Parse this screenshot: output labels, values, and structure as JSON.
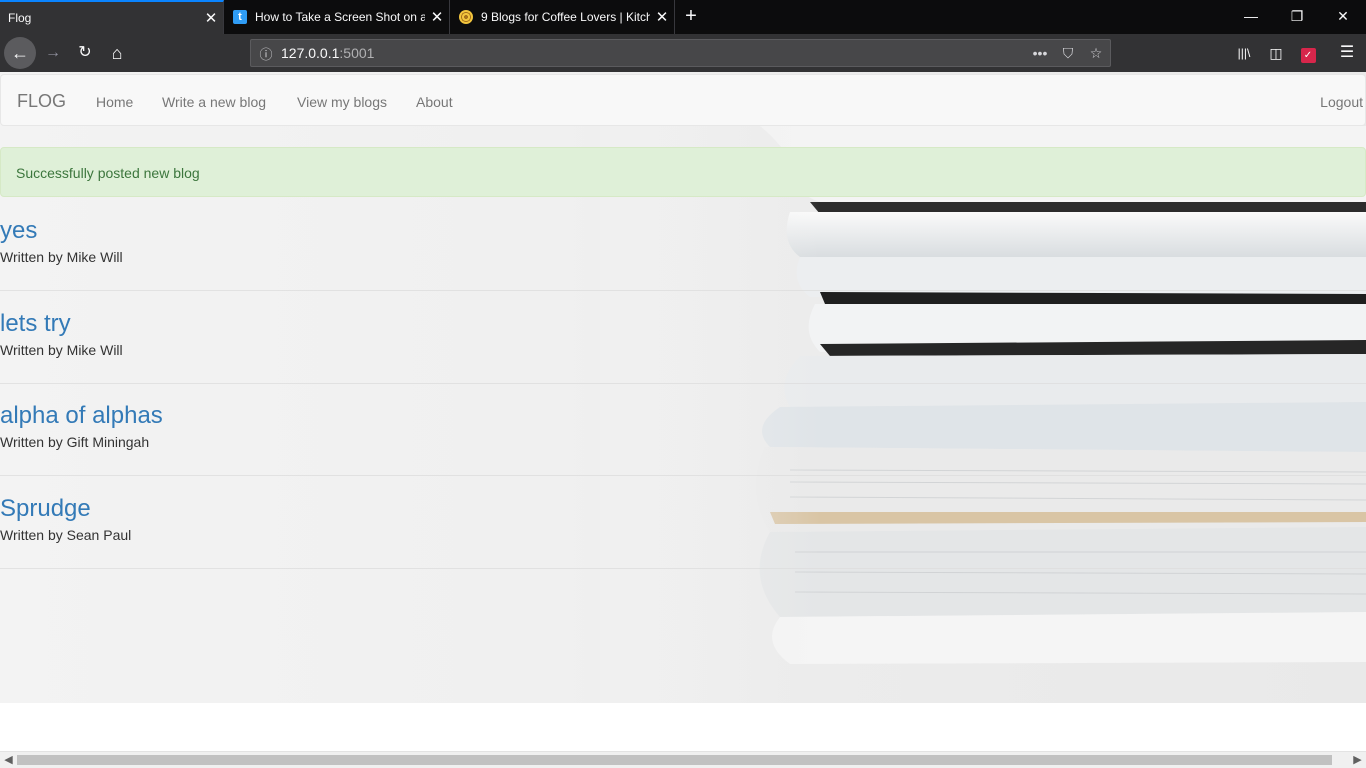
{
  "browser": {
    "tabs": [
      {
        "title": "Flog",
        "active": true
      },
      {
        "title": "How to Take a Screen Shot on a",
        "favicon_letter": "t"
      },
      {
        "title": "9 Blogs for Coffee Lovers | Kitch"
      }
    ],
    "new_tab": "+",
    "window_controls": {
      "minimize": "—",
      "restore": "❐",
      "close": "✕"
    },
    "nav": {
      "back": "←",
      "forward": "→",
      "reload": "↻",
      "home": "⌂"
    },
    "url": {
      "info_icon": "ⓘ",
      "host": "127.0.0.1",
      "port": ":5001"
    },
    "url_actions": {
      "more": "•••",
      "pocket": "⛉",
      "bookmark": "☆"
    },
    "toolbar": {
      "library": "|||\\",
      "sidebar": "◫",
      "pocket": "✓",
      "menu": "☰"
    }
  },
  "site": {
    "brand": "FLOG",
    "nav_links": [
      "Home",
      "Write a new blog",
      "View my blogs",
      "About"
    ],
    "logout": "Logout"
  },
  "alert": "Successfully posted new blog",
  "posts": [
    {
      "title": "yes",
      "author": "Written by Mike Will"
    },
    {
      "title": "lets try",
      "author": "Written by Mike Will"
    },
    {
      "title": "alpha of alphas",
      "author": "Written by Gift Miningah"
    },
    {
      "title": "Sprudge",
      "author": "Written by Sean Paul"
    }
  ],
  "scrollbar": {
    "left": "◀",
    "right": "▶"
  }
}
